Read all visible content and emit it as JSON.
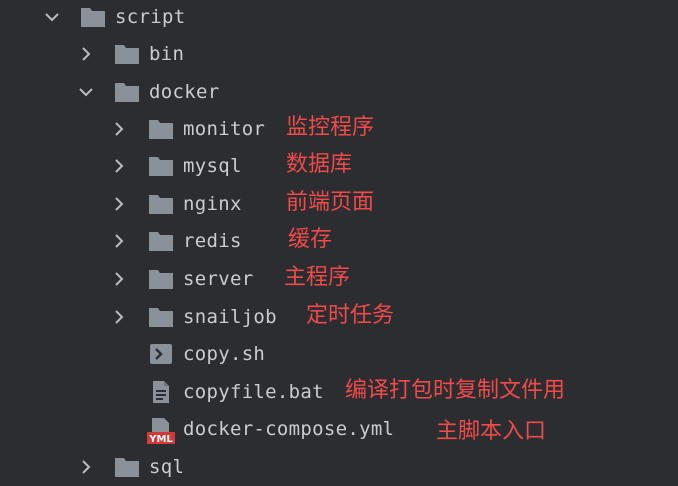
{
  "tree": {
    "root": {
      "name": "script",
      "expanded": true,
      "icon": "folder-icon"
    },
    "children": [
      {
        "name": "bin",
        "expanded": false,
        "icon": "folder-icon"
      },
      {
        "name": "docker",
        "expanded": true,
        "icon": "folder-icon",
        "children": [
          {
            "name": "monitor",
            "expanded": false,
            "icon": "folder-icon",
            "note": "监控程序"
          },
          {
            "name": "mysql",
            "expanded": false,
            "icon": "folder-icon",
            "note": "数据库"
          },
          {
            "name": "nginx",
            "expanded": false,
            "icon": "folder-icon",
            "note": "前端页面"
          },
          {
            "name": "redis",
            "expanded": false,
            "icon": "folder-icon",
            "note": "缓存"
          },
          {
            "name": "server",
            "expanded": false,
            "icon": "folder-icon",
            "note": "主程序"
          },
          {
            "name": "snailjob",
            "expanded": false,
            "icon": "folder-icon",
            "note": "定时任务"
          },
          {
            "name": "copy.sh",
            "icon": "shell-script-icon"
          },
          {
            "name": "copyfile.bat",
            "icon": "text-file-icon",
            "note": "编译打包时复制文件用"
          },
          {
            "name": "docker-compose.yml",
            "icon": "yaml-file-icon",
            "icon_label": "YML",
            "note": "主脚本入口"
          }
        ]
      },
      {
        "name": "sql",
        "expanded": false,
        "icon": "folder-icon"
      }
    ]
  },
  "colors": {
    "background": "#2b2d30",
    "text": "#c9ccd1",
    "folder": "#8a9199",
    "chevron": "#b8bcc2",
    "annotation": "#f04a4a",
    "yaml_badge": "#d23a3a"
  }
}
